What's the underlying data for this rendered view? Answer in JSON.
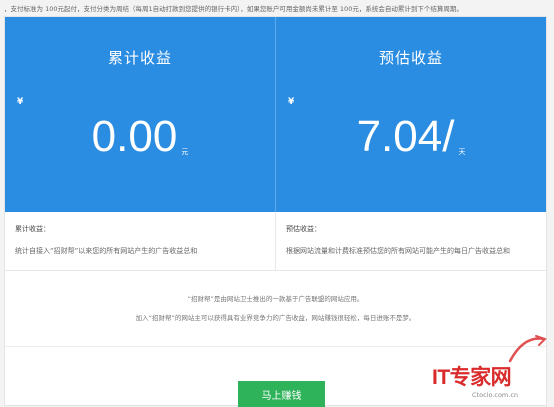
{
  "notice": "，支付标准为 100元起付，支付分类为周结（每周1自动打款到您提供的银行卡内），如果您账户可用金额尚未累计至 100元，系统会自动累计到下个结算周期。",
  "stats": [
    {
      "title": "累计收益",
      "currency": "¥",
      "amount": "0.00",
      "unit": "元"
    },
    {
      "title": "预估收益",
      "currency": "¥",
      "amount": "7.04/",
      "unit": "天"
    }
  ],
  "descs": [
    {
      "title": "累计收益：",
      "text": "统计自接入“招财帮”以来您的所有网站产生的广告收益总和"
    },
    {
      "title": "预估收益：",
      "text": "根据网站流量和计费标准预估您的所有网站可能产生的每日广告收益总和"
    }
  ],
  "intro": {
    "line1": "“招财帮”是由网站卫士推出的一款基于广告联盟的网站应用。",
    "line2": "加入“招财帮”的网站主可以获得具有业界竞争力的广告收益，网站赚钱很轻松，每日进账不是梦。"
  },
  "cta_label": "马上赚钱",
  "watermark": {
    "brand": "IT专家网",
    "domain": "Ctocio.com.cn"
  },
  "colors": {
    "accent": "#2b8de2",
    "cta": "#2fb35a",
    "watermark": "#d92b2b"
  }
}
